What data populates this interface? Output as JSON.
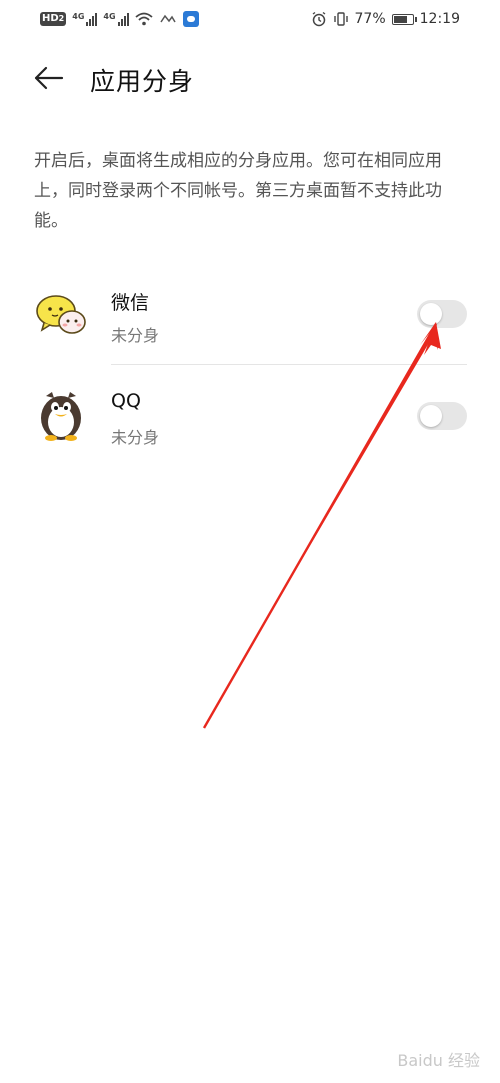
{
  "status_bar": {
    "hd_label": "HD",
    "hd_sub": "2",
    "sig1": "4G",
    "sig2": "4G",
    "battery_text": "77%",
    "battery_level": 0.77,
    "time": "12:19"
  },
  "header": {
    "title": "应用分身"
  },
  "description": "开启后，桌面将生成相应的分身应用。您可在相同应用上，同时登录两个不同帐号。第三方桌面暂不支持此功能。",
  "apps": [
    {
      "name": "微信",
      "status": "未分身",
      "enabled": false
    },
    {
      "name": "QQ",
      "status": "未分身",
      "enabled": false
    }
  ],
  "watermark": "Baidu 经验",
  "colors": {
    "annotation_arrow": "#e8281e",
    "switch_off": "#e6e6e6"
  }
}
